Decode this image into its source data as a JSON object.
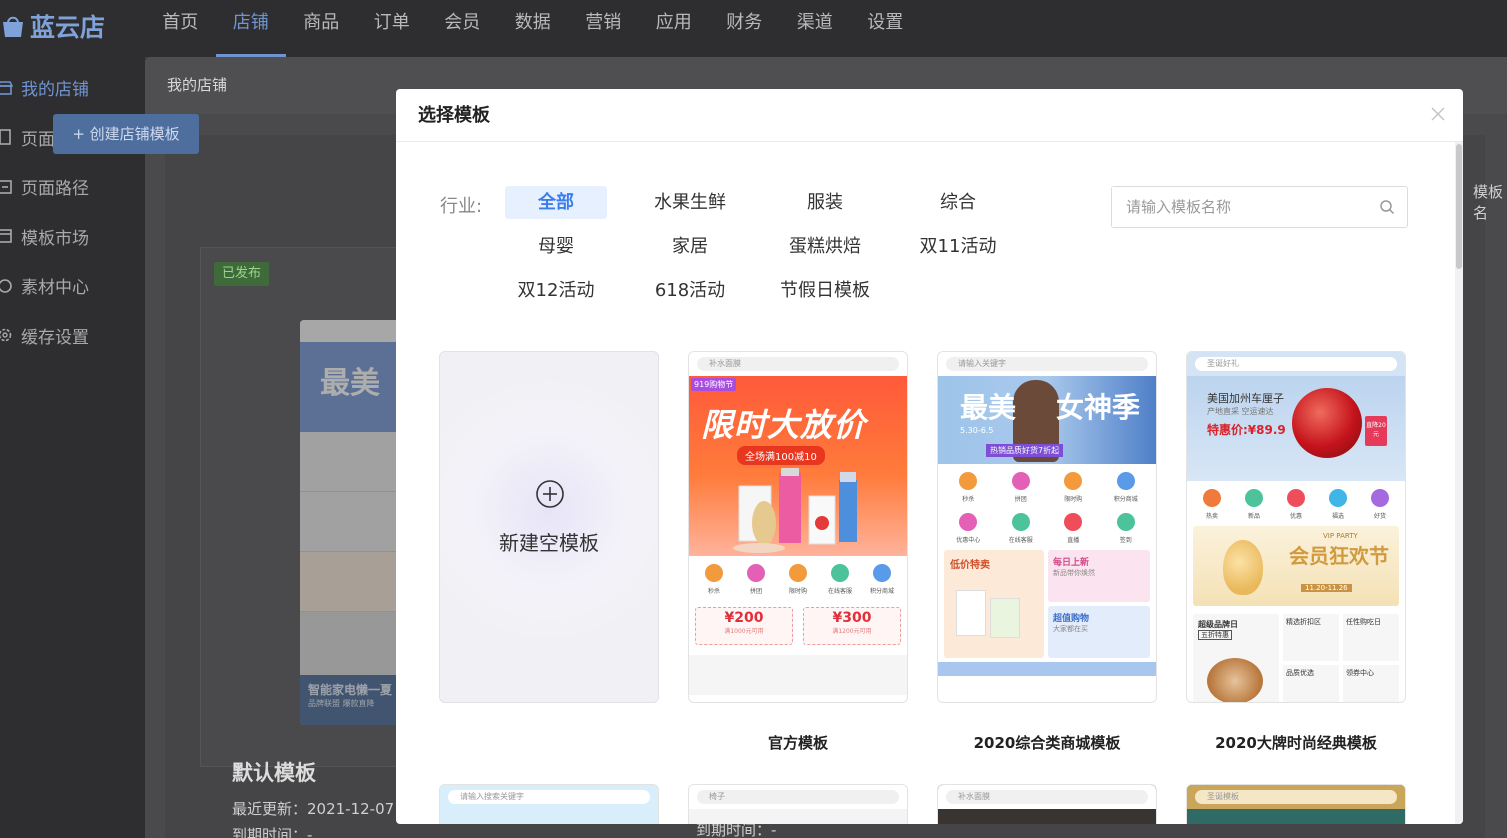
{
  "app": {
    "logo_text": "蓝云店",
    "top_nav": [
      "首页",
      "店铺",
      "商品",
      "订单",
      "会员",
      "数据",
      "营销",
      "应用",
      "财务",
      "渠道",
      "设置"
    ],
    "top_nav_active": "店铺",
    "sidebar": [
      "我的店铺",
      "页面管理",
      "页面路径",
      "模板市场",
      "素材中心",
      "缓存设置"
    ],
    "sidebar_active": "我的店铺",
    "breadcrumb": "我的店铺",
    "create_button": "+ 创建店铺模板",
    "published_badge": "已发布",
    "preview_banner_text": "最美",
    "preview_bottom_text": "智能家电懒一夏",
    "preview_bottom_sub": "品牌联盟 爆款直降",
    "default_template_title": "默认模板",
    "last_update": "最近更新：2021-12-07",
    "expire": "到期时间：-",
    "expire_right": "到期时间：-",
    "template_label_right": "模板名"
  },
  "modal": {
    "title": "选择模板",
    "industry_label": "行业:",
    "categories": [
      "全部",
      "水果生鲜",
      "服装",
      "综合",
      "母婴",
      "家居",
      "蛋糕烘焙",
      "双11活动",
      "双12活动",
      "618活动",
      "节假日模板"
    ],
    "active_category": "全部",
    "search_placeholder": "请输入模板名称",
    "new_template_label": "新建空模板",
    "templates": [
      {
        "name": "官方模板",
        "search": "补水面膜",
        "tag": "919购物节",
        "headline": "限时大放价",
        "sub": "全场满100减10",
        "icons": [
          "秒杀",
          "拼团",
          "限时购",
          "在线客服",
          "积分商城"
        ],
        "coupons": [
          {
            "value": "¥200",
            "desc": "满1000元可用"
          },
          {
            "value": "¥300",
            "desc": "满1200元可用"
          }
        ]
      },
      {
        "name": "2020综合类商城模板",
        "search": "请输入关键字",
        "headline_left": "最美",
        "headline_right": "女神季",
        "date": "5.30-6.5",
        "pill": "热销品质好货7折起",
        "icons_row1": [
          "秒杀",
          "拼团",
          "限时购",
          "积分商城"
        ],
        "icons_row2": [
          "优惠中心",
          "在线客服",
          "直播",
          "签到"
        ],
        "sale_left": "低价特卖",
        "sale_right_top": "每日上新",
        "sale_right_top_sub": "新品带你焕然",
        "sale_right_bottom": "超值购物",
        "sale_right_bottom_sub": "大家都在买"
      },
      {
        "name": "2020大牌时尚经典模板",
        "search": "圣诞好礼",
        "banner_title": "美国加州车厘子",
        "banner_sub": "产地直采 空运速达",
        "banner_price": "特惠价:¥89.9",
        "price_tag": "直降20元",
        "icons": [
          "热卖",
          "新品",
          "优惠",
          "福选",
          "好货"
        ],
        "party_title": "会员狂欢节",
        "party_sub": "VIP PARTY",
        "party_date": "11.20-11.26",
        "food_left": "超级品牌日",
        "food_left_sub": "五折特惠",
        "food_r1": "精选折扣区",
        "food_r2": "任性购吃日",
        "food_r3": "品质优选",
        "food_r4": "领券中心"
      }
    ],
    "row2_searches": [
      "请输入搜索关键字",
      "椅子",
      "补水面膜",
      "圣诞模板"
    ]
  },
  "colors": {
    "accent": "#3a7df0",
    "active_bg": "#e6f0ff",
    "overlay_nav": "#2e2e31"
  }
}
